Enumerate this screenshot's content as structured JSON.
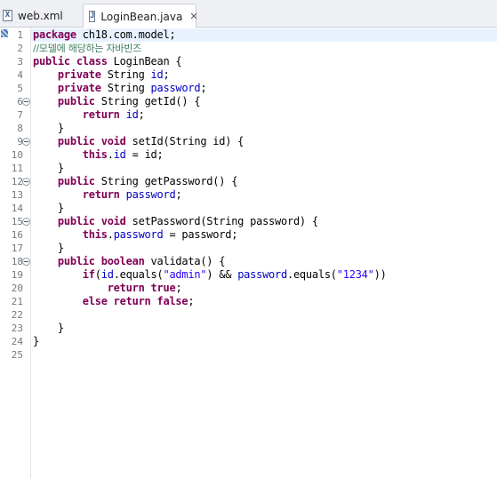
{
  "tabs": [
    {
      "label": "web.xml",
      "icon": "xml-file-icon",
      "active": false
    },
    {
      "label": "LoginBean.java",
      "icon": "java-file-icon",
      "active": true,
      "close": "✕"
    }
  ],
  "editor": {
    "lines": [
      {
        "n": "1",
        "fold": false,
        "tokens": [
          [
            "kw",
            "package"
          ],
          [
            "t",
            " ch18.com.model;"
          ]
        ]
      },
      {
        "n": "2",
        "fold": false,
        "tokens": [
          [
            "cmt",
            "//모델에 해당하는 자바빈즈"
          ]
        ]
      },
      {
        "n": "3",
        "fold": false,
        "tokens": [
          [
            "kw",
            "public class"
          ],
          [
            "t",
            " LoginBean {"
          ]
        ]
      },
      {
        "n": "4",
        "fold": false,
        "tokens": [
          [
            "t",
            "    "
          ],
          [
            "kw",
            "private"
          ],
          [
            "t",
            " String "
          ],
          [
            "fld",
            "id"
          ],
          [
            "t",
            ";"
          ]
        ]
      },
      {
        "n": "5",
        "fold": false,
        "tokens": [
          [
            "t",
            "    "
          ],
          [
            "kw",
            "private"
          ],
          [
            "t",
            " String "
          ],
          [
            "fld",
            "password"
          ],
          [
            "t",
            ";"
          ]
        ]
      },
      {
        "n": "6",
        "fold": true,
        "tokens": [
          [
            "t",
            "    "
          ],
          [
            "kw",
            "public"
          ],
          [
            "t",
            " String getId() {"
          ]
        ]
      },
      {
        "n": "7",
        "fold": false,
        "tokens": [
          [
            "t",
            "        "
          ],
          [
            "kw",
            "return"
          ],
          [
            "t",
            " "
          ],
          [
            "fld",
            "id"
          ],
          [
            "t",
            ";"
          ]
        ]
      },
      {
        "n": "8",
        "fold": false,
        "tokens": [
          [
            "t",
            "    }"
          ]
        ]
      },
      {
        "n": "9",
        "fold": true,
        "tokens": [
          [
            "t",
            "    "
          ],
          [
            "kw",
            "public void"
          ],
          [
            "t",
            " setId(String id) {"
          ]
        ]
      },
      {
        "n": "10",
        "fold": false,
        "tokens": [
          [
            "t",
            "        "
          ],
          [
            "kw",
            "this"
          ],
          [
            "t",
            "."
          ],
          [
            "fld",
            "id"
          ],
          [
            "t",
            " = id;"
          ]
        ]
      },
      {
        "n": "11",
        "fold": false,
        "tokens": [
          [
            "t",
            "    }"
          ]
        ]
      },
      {
        "n": "12",
        "fold": true,
        "tokens": [
          [
            "t",
            "    "
          ],
          [
            "kw",
            "public"
          ],
          [
            "t",
            " String getPassword() {"
          ]
        ]
      },
      {
        "n": "13",
        "fold": false,
        "tokens": [
          [
            "t",
            "        "
          ],
          [
            "kw",
            "return"
          ],
          [
            "t",
            " "
          ],
          [
            "fld",
            "password"
          ],
          [
            "t",
            ";"
          ]
        ]
      },
      {
        "n": "14",
        "fold": false,
        "tokens": [
          [
            "t",
            "    }"
          ]
        ]
      },
      {
        "n": "15",
        "fold": true,
        "tokens": [
          [
            "t",
            "    "
          ],
          [
            "kw",
            "public void"
          ],
          [
            "t",
            " setPassword(String password) {"
          ]
        ]
      },
      {
        "n": "16",
        "fold": false,
        "tokens": [
          [
            "t",
            "        "
          ],
          [
            "kw",
            "this"
          ],
          [
            "t",
            "."
          ],
          [
            "fld",
            "password"
          ],
          [
            "t",
            " = password;"
          ]
        ]
      },
      {
        "n": "17",
        "fold": false,
        "tokens": [
          [
            "t",
            "    }"
          ]
        ]
      },
      {
        "n": "18",
        "fold": true,
        "tokens": [
          [
            "t",
            "    "
          ],
          [
            "kw",
            "public boolean"
          ],
          [
            "t",
            " validata() {"
          ]
        ]
      },
      {
        "n": "19",
        "fold": false,
        "tokens": [
          [
            "t",
            "        "
          ],
          [
            "kw",
            "if"
          ],
          [
            "t",
            "("
          ],
          [
            "fld",
            "id"
          ],
          [
            "t",
            ".equals("
          ],
          [
            "str",
            "\"admin\""
          ],
          [
            "t",
            ") && "
          ],
          [
            "fld",
            "password"
          ],
          [
            "t",
            ".equals("
          ],
          [
            "str",
            "\"1234\""
          ],
          [
            "t",
            "))"
          ]
        ]
      },
      {
        "n": "20",
        "fold": false,
        "tokens": [
          [
            "t",
            "            "
          ],
          [
            "kw",
            "return true"
          ],
          [
            "t",
            ";"
          ]
        ]
      },
      {
        "n": "21",
        "fold": false,
        "tokens": [
          [
            "t",
            "        "
          ],
          [
            "kw",
            "else return false"
          ],
          [
            "t",
            ";"
          ]
        ]
      },
      {
        "n": "22",
        "fold": false,
        "tokens": []
      },
      {
        "n": "23",
        "fold": false,
        "tokens": [
          [
            "t",
            "    }"
          ]
        ]
      },
      {
        "n": "24",
        "fold": false,
        "tokens": [
          [
            "t",
            "}"
          ]
        ]
      },
      {
        "n": "25",
        "fold": false,
        "tokens": []
      }
    ]
  },
  "colors": {
    "keyword": "#7f0055",
    "field": "#0000c0",
    "string": "#2a00ff",
    "comment": "#3f7f5f",
    "line_number": "#787878",
    "current_line": "#e8f2fe"
  }
}
